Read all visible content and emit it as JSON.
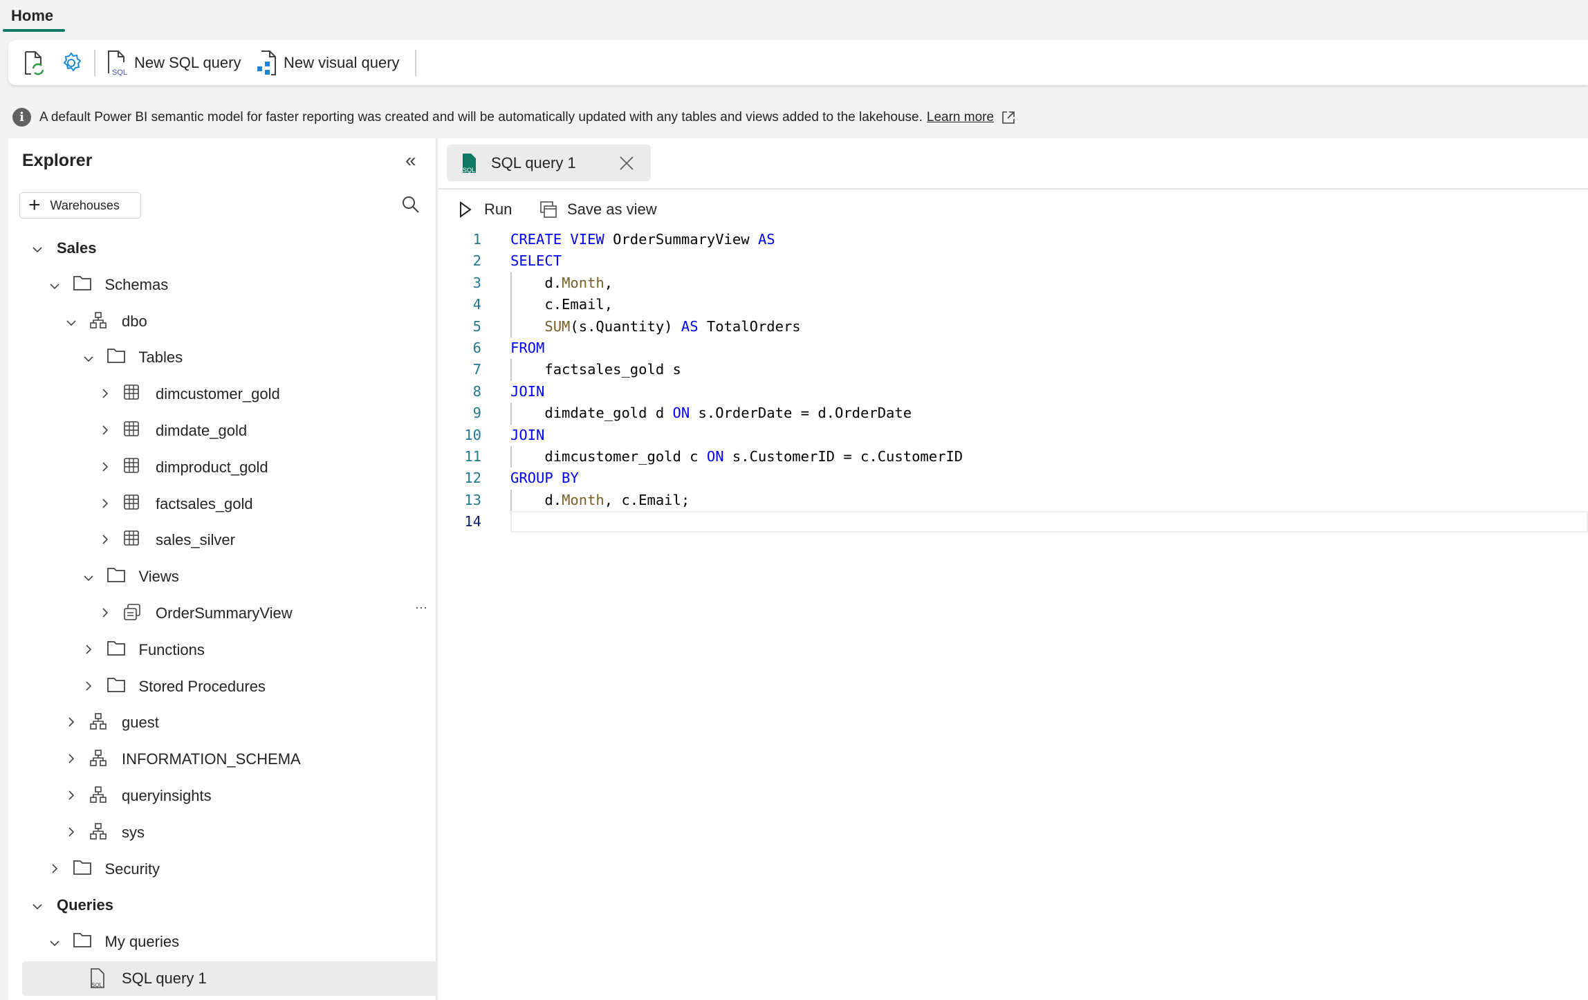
{
  "ribbon": {
    "tab": "Home",
    "new_sql": "New SQL query",
    "new_visual": "New visual query"
  },
  "info": {
    "message": "A default Power BI semantic model for faster reporting was created and will be automatically updated with any tables and views added to the lakehouse.",
    "link": "Learn more"
  },
  "explorer": {
    "title": "Explorer",
    "warehouses": "Warehouses",
    "tree": [
      {
        "level": 0,
        "label": "Sales",
        "icon": "none",
        "state": "open",
        "bold": true
      },
      {
        "level": 1,
        "label": "Schemas",
        "icon": "folder",
        "state": "open"
      },
      {
        "level": 2,
        "label": "dbo",
        "icon": "schema",
        "state": "open"
      },
      {
        "level": 3,
        "label": "Tables",
        "icon": "folder",
        "state": "open"
      },
      {
        "level": 4,
        "label": "dimcustomer_gold",
        "icon": "table",
        "state": "closed"
      },
      {
        "level": 4,
        "label": "dimdate_gold",
        "icon": "table",
        "state": "closed"
      },
      {
        "level": 4,
        "label": "dimproduct_gold",
        "icon": "table",
        "state": "closed"
      },
      {
        "level": 4,
        "label": "factsales_gold",
        "icon": "table",
        "state": "closed"
      },
      {
        "level": 4,
        "label": "sales_silver",
        "icon": "table",
        "state": "closed"
      },
      {
        "level": 3,
        "label": "Views",
        "icon": "folder",
        "state": "open"
      },
      {
        "level": 4,
        "label": "OrderSummaryView",
        "icon": "view",
        "state": "closed",
        "more": "···"
      },
      {
        "level": 3,
        "label": "Functions",
        "icon": "folder",
        "state": "closed"
      },
      {
        "level": 3,
        "label": "Stored Procedures",
        "icon": "folder",
        "state": "closed"
      },
      {
        "level": 2,
        "label": "guest",
        "icon": "schema",
        "state": "closed"
      },
      {
        "level": 2,
        "label": "INFORMATION_SCHEMA",
        "icon": "schema",
        "state": "closed"
      },
      {
        "level": 2,
        "label": "queryinsights",
        "icon": "schema",
        "state": "closed"
      },
      {
        "level": 2,
        "label": "sys",
        "icon": "schema",
        "state": "closed"
      },
      {
        "level": 1,
        "label": "Security",
        "icon": "folder",
        "state": "closed"
      },
      {
        "level": 0,
        "label": "Queries",
        "icon": "none",
        "state": "open",
        "bold": true
      },
      {
        "level": 1,
        "label": "My queries",
        "icon": "folder",
        "state": "open"
      },
      {
        "level": 2,
        "label": "SQL query 1",
        "icon": "sqlfile",
        "state": "none",
        "selected": true
      }
    ]
  },
  "editor": {
    "tab": "SQL query 1",
    "run": "Run",
    "save_as_view": "Save as view",
    "current_line": 14,
    "lines": [
      [
        [
          "kw",
          "CREATE VIEW "
        ],
        [
          "tx",
          "OrderSummaryView "
        ],
        [
          "kw",
          "AS"
        ]
      ],
      [
        [
          "kw",
          "SELECT"
        ]
      ],
      [
        [
          "tx",
          "    d."
        ],
        [
          "fn",
          "Month"
        ],
        [
          "tx",
          ","
        ]
      ],
      [
        [
          "tx",
          "    c.Email,"
        ]
      ],
      [
        [
          "fn",
          "    SUM"
        ],
        [
          "tx",
          "(s.Quantity) "
        ],
        [
          "kw",
          "AS"
        ],
        [
          "tx",
          " TotalOrders"
        ]
      ],
      [
        [
          "kw",
          "FROM"
        ]
      ],
      [
        [
          "tx",
          "    factsales_gold s"
        ]
      ],
      [
        [
          "kw",
          "JOIN"
        ]
      ],
      [
        [
          "tx",
          "    dimdate_gold d "
        ],
        [
          "kw",
          "ON"
        ],
        [
          "tx",
          " s.OrderDate = d.OrderDate"
        ]
      ],
      [
        [
          "kw",
          "JOIN"
        ]
      ],
      [
        [
          "tx",
          "    dimcustomer_gold c "
        ],
        [
          "kw",
          "ON"
        ],
        [
          "tx",
          " s.CustomerID = c.CustomerID"
        ]
      ],
      [
        [
          "kw",
          "GROUP BY"
        ]
      ],
      [
        [
          "tx",
          "    d."
        ],
        [
          "fn",
          "Month"
        ],
        [
          "tx",
          ", c.Email;"
        ]
      ],
      []
    ]
  },
  "colors": {
    "accent": "#117865",
    "keyword": "#0000ff",
    "function": "#795e26",
    "line_number": "#237893"
  }
}
